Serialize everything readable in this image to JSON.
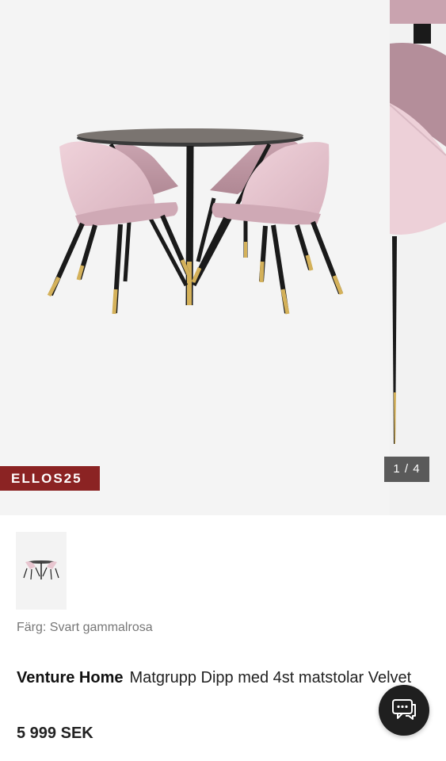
{
  "gallery": {
    "promo_code": "ELLOS25",
    "counter": "1 / 4"
  },
  "product": {
    "color_label": "Färg: Svart gammalrosa",
    "brand": "Venture Home",
    "name": "Matgrupp Dipp med 4st matstolar Velvet",
    "price": "5 999 SEK"
  },
  "icons": {
    "chat": "chat-icon"
  },
  "colors": {
    "promo_badge": "#8b2323",
    "chair_velvet": "#e8c6d0",
    "gold_tip": "#d4b15a"
  }
}
